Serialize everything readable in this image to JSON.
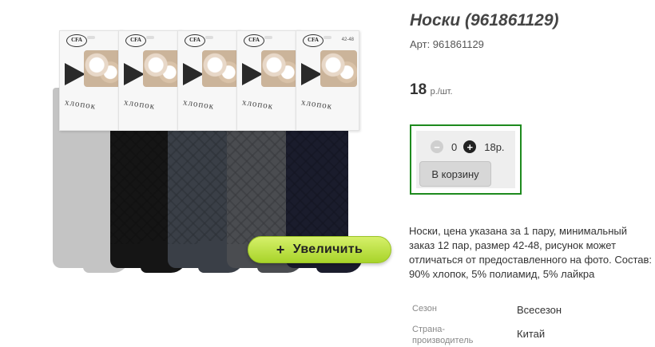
{
  "product": {
    "title": "Носки (961861129)",
    "article": "Арт: 961861129",
    "price_value": "18",
    "price_unit": "р./шт.",
    "zoom_plus": "+",
    "zoom_label": "Увеличить",
    "description": "Носки, цена указана за 1 пару, минимальный заказ 12 пар, размер 42-48, рисунок может отличаться от предоставленного на фото. Состав: 90% хлопок, 5% полиамид, 5% лайкра"
  },
  "buy": {
    "minus": "−",
    "plus": "+",
    "quantity": "0",
    "total": "18р.",
    "cart_label": "В корзину"
  },
  "photo": {
    "brand": "CFA",
    "tag_word": "хлопок",
    "tag_size": "42-48",
    "sock_colors": [
      "#c4c4c4",
      "#151515",
      "#3a3f47",
      "#4a4c50",
      "#1a1c2c"
    ]
  },
  "properties": [
    {
      "key": "Сезон",
      "value": "Всесезон"
    },
    {
      "key": "Страна-производитель",
      "value": "Китай"
    }
  ],
  "colors": {
    "buybox_border": "#1e8a1e",
    "zoom_button": "#b8dc3c"
  }
}
